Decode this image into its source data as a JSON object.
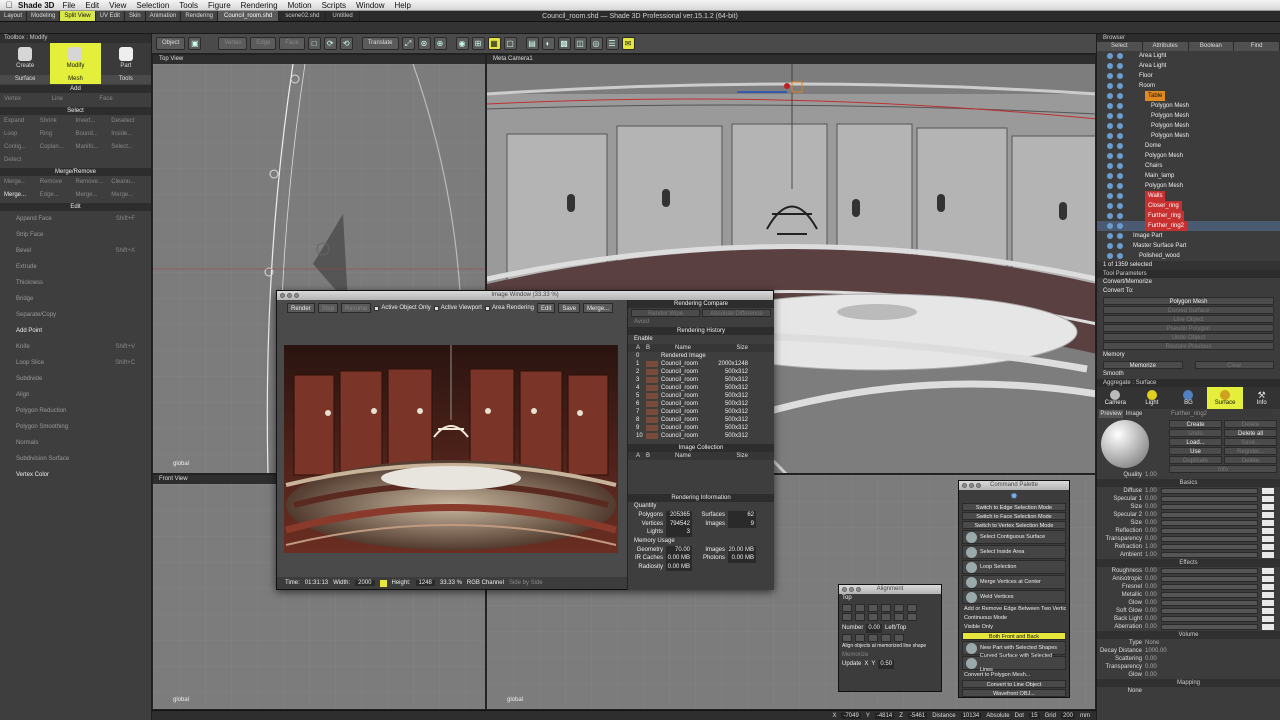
{
  "menubar": {
    "app": "Shade 3D",
    "items": [
      "File",
      "Edit",
      "View",
      "Selection",
      "Tools",
      "Figure",
      "Rendering",
      "Motion",
      "Scripts",
      "Window",
      "Help"
    ]
  },
  "workspace_tabs": [
    "Layout",
    "Modeling",
    "Split View",
    "UV Edit",
    "Skin",
    "Animation",
    "Rendering"
  ],
  "file_tabs": [
    "Council_room.shd",
    "scene02.shd",
    "Untitled"
  ],
  "window_title": "Council_room.shd — Shade 3D Professional ver.15.1.2 (64-bit)",
  "toolbar": {
    "object": "Object",
    "vertex": "Vertex",
    "edge": "Edge",
    "face": "Face",
    "translate": "Translate"
  },
  "toolbox": {
    "title": "Toolbox : Modify",
    "modes": [
      "Create",
      "Modify",
      "Part"
    ],
    "subtabs": [
      "Surface",
      "Mesh",
      "Tools"
    ],
    "add": {
      "header": "Add",
      "items": [
        "Vertex",
        "Line",
        "Face"
      ]
    },
    "select": {
      "header": "Select",
      "rows": [
        [
          "Expand",
          "Shrink",
          "Invert...",
          "Deselect"
        ],
        [
          "Loop",
          "Ring",
          "Bound...",
          "Inside..."
        ],
        [
          "Contig...",
          "Coplan...",
          "Manifo...",
          "Select..."
        ],
        [
          "Detect"
        ]
      ]
    },
    "merge": {
      "header": "Merge/Remove",
      "rows": [
        [
          "Merge...",
          "Remove",
          "Remove...",
          "Cleanu..."
        ],
        [
          "Merge...",
          "Edge...",
          "Merge...",
          "Merge..."
        ]
      ]
    },
    "edit": {
      "header": "Edit",
      "items": [
        {
          "label": "Append Face",
          "shortcut": "Shift+F"
        },
        {
          "label": "Strip Face",
          "shortcut": ""
        },
        {
          "label": "Bevel",
          "shortcut": "Shift+X"
        },
        {
          "label": "Extrude",
          "shortcut": ""
        },
        {
          "label": "Thickness",
          "shortcut": ""
        },
        {
          "label": "Bridge",
          "shortcut": ""
        },
        {
          "label": "Separate/Copy",
          "shortcut": ""
        },
        {
          "label": "Add Point",
          "shortcut": ""
        },
        {
          "label": "Knife",
          "shortcut": "Shift+V"
        },
        {
          "label": "Loop Slice",
          "shortcut": "Shift+C"
        },
        {
          "label": "Subdivide",
          "shortcut": ""
        },
        {
          "label": "Align",
          "shortcut": ""
        },
        {
          "label": "Polygon Reduction",
          "shortcut": ""
        },
        {
          "label": "Polygon Smoothing",
          "shortcut": ""
        },
        {
          "label": "Normals",
          "shortcut": ""
        },
        {
          "label": "Subdivision Surface",
          "shortcut": ""
        },
        {
          "label": "Vertex Color",
          "shortcut": ""
        }
      ]
    }
  },
  "viewports": {
    "top": {
      "title": "Top View",
      "footer": "global"
    },
    "camera": {
      "title": "Meta Camera1"
    },
    "front": {
      "title": "Front View",
      "footer": "global"
    },
    "side": {
      "footer": "global"
    }
  },
  "image_window": {
    "title": "Image Window (33.33 %)",
    "buttons": [
      "Render",
      "Stop",
      "Resume"
    ],
    "checks": [
      "Active Object Only",
      "Active Viewport",
      "Area Rendering"
    ],
    "actions": [
      "Edit",
      "Save",
      "Merge..."
    ],
    "footer": {
      "time_label": "Time:",
      "time": "01:31:13",
      "width_label": "Width:",
      "width": "2000",
      "height_label": "Height:",
      "height": "1248",
      "zoom": "33.33 %",
      "channel": "RGB Channel",
      "sbs": "Side by Side"
    },
    "compare": {
      "header": "Rendering Compare",
      "wipe": "Render Wipe",
      "absdiff": "Absolute Difference",
      "avoid": "Avoid"
    },
    "history": {
      "header": "Rendering History",
      "enable": "Enable",
      "cols": [
        "A",
        "B",
        "Name",
        "Size"
      ],
      "rows": [
        {
          "n": "0",
          "name": "Rendered Image",
          "size": ""
        },
        {
          "n": "1",
          "name": "Council_room",
          "size": "2000x1248"
        },
        {
          "n": "2",
          "name": "Council_room",
          "size": "500x312"
        },
        {
          "n": "3",
          "name": "Council_room",
          "size": "500x312"
        },
        {
          "n": "4",
          "name": "Council_room",
          "size": "500x312"
        },
        {
          "n": "5",
          "name": "Council_room",
          "size": "500x312"
        },
        {
          "n": "6",
          "name": "Council_room",
          "size": "500x312"
        },
        {
          "n": "7",
          "name": "Council_room",
          "size": "500x312"
        },
        {
          "n": "8",
          "name": "Council_room",
          "size": "500x312"
        },
        {
          "n": "9",
          "name": "Council_room",
          "size": "500x312"
        },
        {
          "n": "10",
          "name": "Council_room",
          "size": "500x312"
        }
      ]
    },
    "collection": {
      "header": "Image Collection",
      "cols": [
        "A",
        "B",
        "Name",
        "Size"
      ]
    },
    "info": {
      "header": "Rendering Information",
      "quantity": "Quantity",
      "polygons_label": "Polygons",
      "polygons": "205365",
      "surfaces_label": "Surfaces",
      "surfaces": "62",
      "vertices_label": "Vertices",
      "vertices": "794542",
      "images_label": "Images",
      "images": "9",
      "lights_label": "Lights",
      "lights": "3",
      "memory": "Memory Usage",
      "geometry_label": "Geometry",
      "geometry": "70.00 MB",
      "images_mem_label": "Images",
      "images_mem": "20.00 MB",
      "ircaches_label": "IR Caches",
      "ircaches": "0.00 MB",
      "photons_label": "Photons",
      "photons": "0.00 MB",
      "radiosity_label": "Radiosity",
      "radiosity": "0.00 MB"
    }
  },
  "browser": {
    "title": "Browser",
    "tabs": [
      "Select",
      "Attributes",
      "Boolean",
      "Find"
    ],
    "items": [
      {
        "label": "Area Light",
        "indent": 2,
        "style": ""
      },
      {
        "label": "Area Light",
        "indent": 2,
        "style": ""
      },
      {
        "label": "Floor",
        "indent": 2,
        "style": ""
      },
      {
        "label": "Room",
        "indent": 2,
        "style": ""
      },
      {
        "label": "Table",
        "indent": 3,
        "style": "org"
      },
      {
        "label": "Polygon Mesh",
        "indent": 4,
        "style": ""
      },
      {
        "label": "Polygon Mesh",
        "indent": 4,
        "style": ""
      },
      {
        "label": "Polygon Mesh",
        "indent": 4,
        "style": ""
      },
      {
        "label": "Polygon Mesh",
        "indent": 4,
        "style": ""
      },
      {
        "label": "Dome",
        "indent": 3,
        "style": ""
      },
      {
        "label": "Polygon Mesh",
        "indent": 3,
        "style": ""
      },
      {
        "label": "Chairs",
        "indent": 3,
        "style": ""
      },
      {
        "label": "Main_lamp",
        "indent": 3,
        "style": ""
      },
      {
        "label": "Polygon Mesh",
        "indent": 3,
        "style": ""
      },
      {
        "label": "Walls",
        "indent": 3,
        "style": "red"
      },
      {
        "label": "Closer_ring",
        "indent": 3,
        "style": "red"
      },
      {
        "label": "Further_ring",
        "indent": 3,
        "style": "red"
      },
      {
        "label": "Further_ring2",
        "indent": 3,
        "style": "red",
        "selected": true
      },
      {
        "label": "Image Part",
        "indent": 1,
        "style": ""
      },
      {
        "label": "Master Surface Part",
        "indent": 1,
        "style": ""
      },
      {
        "label": "Polished_wood",
        "indent": 2,
        "style": ""
      }
    ],
    "count": "1 of 1359 selected"
  },
  "tool_params": {
    "title": "Tool Parameters",
    "subtitle": "Convert/Memorize",
    "convert_to": "Convert To:",
    "options": [
      "Polygon Mesh",
      "Curved Surface",
      "Line Object",
      "Pseudo Polygon",
      "Undo Object",
      "Restore Previous"
    ],
    "memory": "Memory",
    "memorize": "Memorize",
    "clear": "Clear",
    "smooth": "Smooth"
  },
  "aggregate": {
    "title": "Aggregate : Surface",
    "icons": [
      "Camera",
      "Light",
      "BG",
      "Surface",
      "Info"
    ],
    "preview_tab": "Preview",
    "image_tab": "Image",
    "name": "Further_ring2",
    "buttons": [
      [
        "Create",
        "Delete"
      ],
      [
        "Undo",
        "Delete all"
      ],
      [
        "Load...",
        "Save..."
      ],
      [
        "Use",
        "Register..."
      ],
      [
        "Duplicate",
        "Delete"
      ]
    ],
    "info": "Info",
    "quality_label": "Quality",
    "quality": "1.00",
    "basics": "Basics",
    "basic_rows": [
      [
        "Diffuse",
        "1.00"
      ],
      [
        "Specular 1",
        "0.00"
      ],
      [
        "Size",
        "0.00"
      ],
      [
        "Specular 2",
        "0.00"
      ],
      [
        "Size",
        "0.00"
      ],
      [
        "Reflection",
        "0.00"
      ],
      [
        "Transparency",
        "0.00"
      ],
      [
        "Refraction",
        "1.00"
      ],
      [
        "Ambient",
        "1.00"
      ]
    ],
    "effects": "Effects",
    "effect_rows": [
      [
        "Roughness",
        "0.00"
      ],
      [
        "Anisotropic",
        "0.00"
      ],
      [
        "Fresnel",
        "0.00"
      ],
      [
        "Metallic",
        "0.00"
      ],
      [
        "Glow",
        "0.00"
      ],
      [
        "Soft Glow",
        "0.00"
      ],
      [
        "Back Light",
        "0.00"
      ],
      [
        "Aberration",
        "0.00"
      ]
    ],
    "volume": "Volume",
    "volume_rows": [
      [
        "Type",
        "None"
      ],
      [
        "Decay Distance",
        "1000.00"
      ],
      [
        "Scattering",
        "0.00"
      ],
      [
        "Transparency",
        "0.00"
      ],
      [
        "Glow",
        "0.00"
      ]
    ],
    "mapping": "Mapping",
    "mapping_type": "None"
  },
  "command_palette": {
    "title": "Command Palette",
    "items": [
      {
        "label": "Switch to Edge Selection Mode",
        "kind": "btn"
      },
      {
        "label": "Switch to Face Selection Mode",
        "kind": "btn"
      },
      {
        "label": "Switch to Vertex Selection Mode",
        "kind": "btn"
      },
      {
        "label": "Select Contiguous Surface",
        "kind": "big"
      },
      {
        "label": "Select Inside Area",
        "kind": "big"
      },
      {
        "label": "Loop Selection",
        "kind": "big"
      },
      {
        "label": "Merge Vertices at Center",
        "kind": "big"
      },
      {
        "label": "Weld Vertices",
        "kind": "big"
      },
      {
        "label": "Add or Remove Edge Between Two Vertices",
        "kind": "plain"
      },
      {
        "label": "Continuous Mode",
        "kind": "plain"
      },
      {
        "label": "Visible Only",
        "kind": "plain"
      },
      {
        "label": "Both Front and Back",
        "kind": "hi"
      },
      {
        "label": "New Part with Selected Shapes",
        "kind": "big"
      },
      {
        "label": "Curved Surface with Selected Lines",
        "kind": "big"
      },
      {
        "label": "Convert to Polygon Mesh...",
        "kind": "plain"
      },
      {
        "label": "Convert to Line Object",
        "kind": "btn"
      },
      {
        "label": "Wavefront OBJ...",
        "kind": "btn"
      }
    ]
  },
  "alignment": {
    "title": "Alignment",
    "top": "Top",
    "number_label": "Number",
    "number": "0.00",
    "lefttop": "Left/Top",
    "memo": "Align objects at memorized line shape",
    "memorize": "Memorize",
    "update": "Update",
    "x": "X",
    "y": "Y",
    "yval": "0.50"
  },
  "status": {
    "x_label": "X",
    "x": "-7049",
    "y_label": "Y",
    "y": "-4814",
    "z_label": "Z",
    "z": "-5461",
    "dist_label": "Distance",
    "dist": "10134",
    "abs": "Absolute",
    "dot_label": "Dot",
    "dot": "15",
    "grid_label": "Grid",
    "grid": "200",
    "unit": "mm"
  },
  "colors": {
    "accent": "#e4ef3c",
    "highlight_red": "#c83030",
    "table_orange": "#e08a20"
  }
}
